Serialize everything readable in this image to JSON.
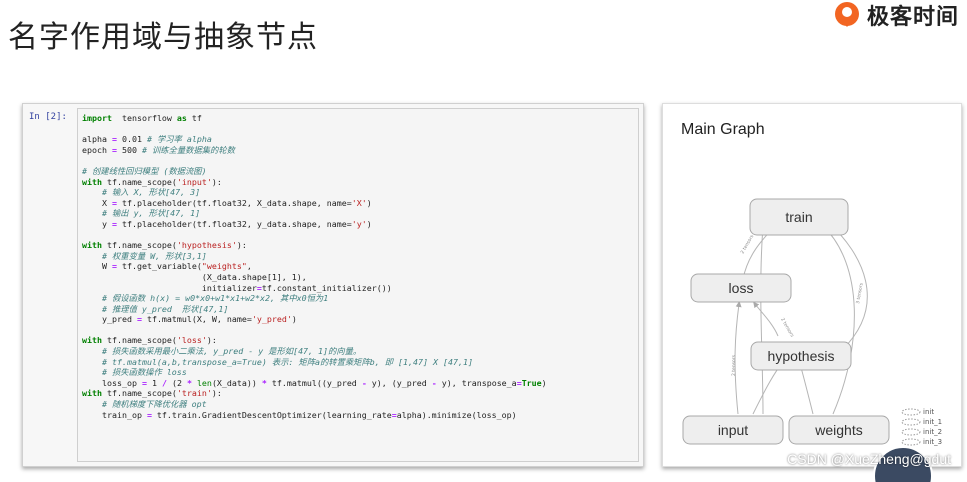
{
  "slide": {
    "title": "名字作用域与抽象节点",
    "brand_name": "极客时间",
    "watermark": "CSDN @XueZheng@gdut",
    "colors": {
      "brand_orange": "#f26522",
      "code_bg": "#f5f5f5",
      "node_fill": "#eeeeee"
    }
  },
  "notebook": {
    "prompt": "In [2]:",
    "lines": [
      [
        [
          "kw",
          "import"
        ],
        [
          "",
          "  tensorflow "
        ],
        [
          "kw",
          "as"
        ],
        [
          "",
          " tf"
        ]
      ],
      [],
      [
        [
          "",
          "alpha "
        ],
        [
          "op",
          "="
        ],
        [
          "",
          " 0.01 "
        ],
        [
          "cm",
          "# 学习率 alpha"
        ]
      ],
      [
        [
          "",
          "epoch "
        ],
        [
          "op",
          "="
        ],
        [
          "",
          " 500 "
        ],
        [
          "cm",
          "# 训练全量数据集的轮数"
        ]
      ],
      [],
      [
        [
          "cm",
          "# 创建线性回归模型 (数据流图)"
        ]
      ],
      [
        [
          "kw",
          "with"
        ],
        [
          "",
          " tf.name_scope("
        ],
        [
          "st",
          "'input'"
        ],
        [
          "",
          "):"
        ]
      ],
      [
        [
          "",
          "    "
        ],
        [
          "cm",
          "# 输入 X, 形状[47, 3]"
        ]
      ],
      [
        [
          "",
          "    X "
        ],
        [
          "op",
          "="
        ],
        [
          "",
          " tf.placeholder(tf.float32, X_data.shape, name="
        ],
        [
          "st",
          "'X'"
        ],
        [
          "",
          ")"
        ]
      ],
      [
        [
          "",
          "    "
        ],
        [
          "cm",
          "# 输出 y, 形状[47, 1]"
        ]
      ],
      [
        [
          "",
          "    y "
        ],
        [
          "op",
          "="
        ],
        [
          "",
          " tf.placeholder(tf.float32, y_data.shape, name="
        ],
        [
          "st",
          "'y'"
        ],
        [
          "",
          ")"
        ]
      ],
      [],
      [
        [
          "kw",
          "with"
        ],
        [
          "",
          " tf.name_scope("
        ],
        [
          "st",
          "'hypothesis'"
        ],
        [
          "",
          "):"
        ]
      ],
      [
        [
          "",
          "    "
        ],
        [
          "cm",
          "# 权重变量 W, 形状[3,1]"
        ]
      ],
      [
        [
          "",
          "    W "
        ],
        [
          "op",
          "="
        ],
        [
          "",
          " tf.get_variable("
        ],
        [
          "st",
          "\"weights\""
        ],
        [
          "",
          ","
        ]
      ],
      [
        [
          "",
          "                        (X_data.shape[1], 1),"
        ]
      ],
      [
        [
          "",
          "                        initializer"
        ],
        [
          "op",
          "="
        ],
        [
          "",
          "tf.constant_initializer())"
        ]
      ],
      [
        [
          "",
          "    "
        ],
        [
          "cm",
          "# 假设函数 h(x) = w0*x0+w1*x1+w2*x2, 其中x0恒为1"
        ]
      ],
      [
        [
          "",
          "    "
        ],
        [
          "cm",
          "# 推理值 y_pred  形状[47,1]"
        ]
      ],
      [
        [
          "",
          "    y_pred "
        ],
        [
          "op",
          "="
        ],
        [
          "",
          " tf.matmul(X, W, name="
        ],
        [
          "st",
          "'y_pred'"
        ],
        [
          "",
          ")"
        ]
      ],
      [],
      [
        [
          "kw",
          "with"
        ],
        [
          "",
          " tf.name_scope("
        ],
        [
          "st",
          "'loss'"
        ],
        [
          "",
          "):"
        ]
      ],
      [
        [
          "",
          "    "
        ],
        [
          "cm",
          "# 损失函数采用最小二乘法, y_pred - y 是形如[47, 1]的向量。"
        ]
      ],
      [
        [
          "",
          "    "
        ],
        [
          "cm",
          "# tf.matmul(a,b,transpose_a=True) 表示: 矩阵a的转置乘矩阵b, 即 [1,47] X [47,1]"
        ]
      ],
      [
        [
          "",
          "    "
        ],
        [
          "cm",
          "# 损失函数操作 loss"
        ]
      ],
      [
        [
          "",
          "    loss_op "
        ],
        [
          "op",
          "="
        ],
        [
          "",
          " 1 "
        ],
        [
          "op",
          "/"
        ],
        [
          "",
          " (2 "
        ],
        [
          "op",
          "*"
        ],
        [
          "",
          " "
        ],
        [
          "nm",
          "len"
        ],
        [
          "",
          "(X_data)) "
        ],
        [
          "op",
          "*"
        ],
        [
          "",
          " tf.matmul((y_pred "
        ],
        [
          "op",
          "-"
        ],
        [
          "",
          " y), (y_pred "
        ],
        [
          "op",
          "-"
        ],
        [
          "",
          " y), transpose_a"
        ],
        [
          "op",
          "="
        ],
        [
          "kw",
          "True"
        ],
        [
          "",
          ")"
        ]
      ],
      [
        [
          "kw",
          "with"
        ],
        [
          "",
          " tf.name_scope("
        ],
        [
          "st",
          "'train'"
        ],
        [
          "",
          "):"
        ]
      ],
      [
        [
          "",
          "    "
        ],
        [
          "cm",
          "# 随机梯度下降优化器 opt"
        ]
      ],
      [
        [
          "",
          "    train_op "
        ],
        [
          "op",
          "="
        ],
        [
          "",
          " tf.train.GradientDescentOptimizer(learning_rate"
        ],
        [
          "op",
          "="
        ],
        [
          "",
          "alpha).minimize(loss_op)"
        ]
      ]
    ]
  },
  "graph": {
    "title": "Main Graph",
    "nodes": {
      "train": "train",
      "loss": "loss",
      "hypothesis": "hypothesis",
      "input": "input",
      "weights": "weights"
    },
    "init_labels": [
      "init",
      "init_1",
      "init_2",
      "init_3"
    ],
    "edge_labels": {
      "tensors_2": "2 tensors",
      "tensors_3": "3 tensors"
    }
  }
}
